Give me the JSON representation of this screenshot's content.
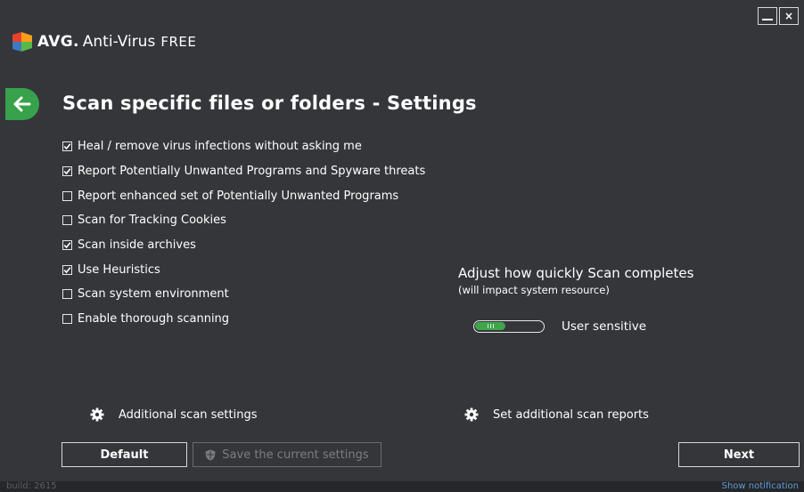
{
  "app": {
    "brand": "AVG.",
    "product": "Anti-Virus",
    "edition": "FREE"
  },
  "window_controls": {
    "minimize": "_",
    "close": "×"
  },
  "page": {
    "title": "Scan specific files or folders - Settings"
  },
  "options": [
    {
      "label": "Heal / remove virus infections without asking me",
      "checked": true
    },
    {
      "label": "Report Potentially Unwanted Programs and Spyware threats",
      "checked": true
    },
    {
      "label": "Report enhanced set of Potentially Unwanted Programs",
      "checked": false
    },
    {
      "label": "Scan for Tracking Cookies",
      "checked": false
    },
    {
      "label": "Scan inside archives",
      "checked": true
    },
    {
      "label": "Use Heuristics",
      "checked": true
    },
    {
      "label": "Scan system environment",
      "checked": false
    },
    {
      "label": "Enable thorough scanning",
      "checked": false
    }
  ],
  "speed": {
    "title": "Adjust how quickly Scan completes",
    "subtitle": "(will impact system resource)",
    "value_label": "User sensitive",
    "level": 0.45
  },
  "links": {
    "additional_settings": "Additional scan settings",
    "additional_reports": "Set additional scan reports"
  },
  "buttons": {
    "default": "Default",
    "save": "Save the current settings",
    "next": "Next"
  },
  "footer": {
    "build": "build: 2615",
    "notification": "Show notification"
  },
  "colors": {
    "background": "#34363a",
    "accent_green": "#37a24b",
    "text": "#ffffff",
    "disabled": "#7b7d80",
    "link_blue": "#5d9bd5"
  }
}
